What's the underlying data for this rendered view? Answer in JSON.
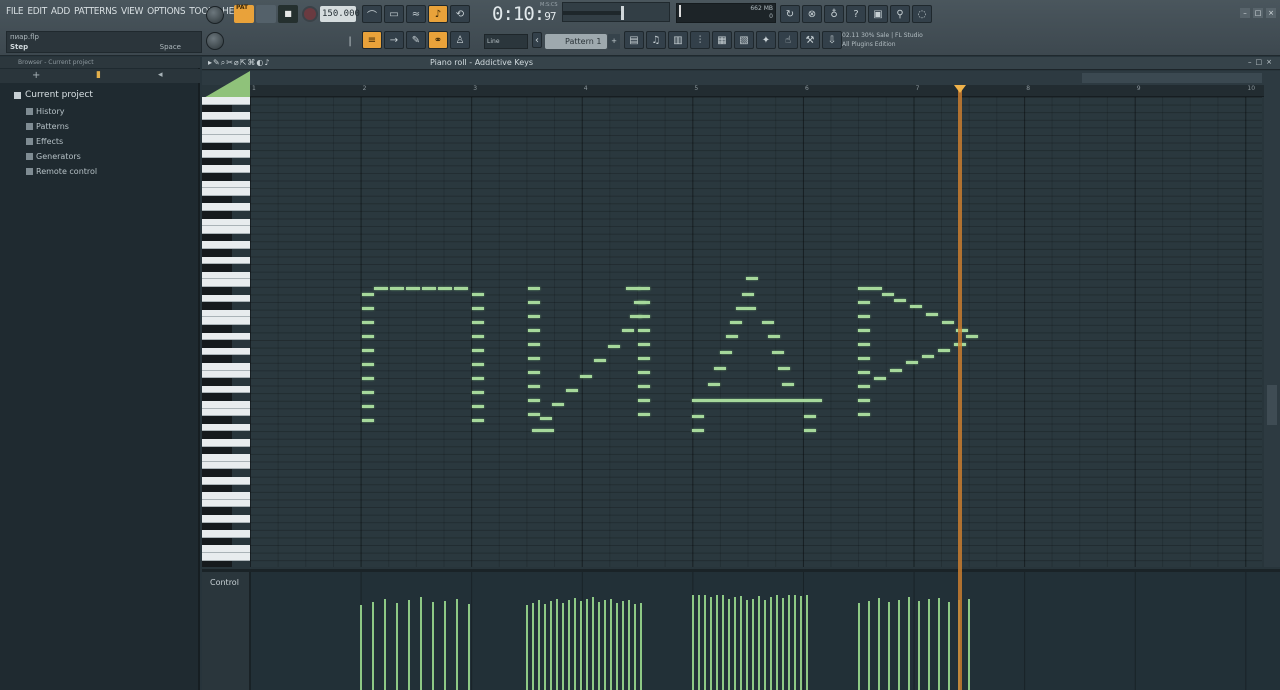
{
  "menu": [
    "FILE",
    "EDIT",
    "ADD",
    "PATTERNS",
    "VIEW",
    "OPTIONS",
    "TOOLS",
    "HELP"
  ],
  "hint": {
    "file": "пиар.flp",
    "step": "Step",
    "key": "Space"
  },
  "transport": {
    "tempo": "150.000",
    "time_main": "0:10",
    "time_sub": "97",
    "time_label": "M:S:CS",
    "pattern": "Pattern 1",
    "snap": "Line"
  },
  "cpu": {
    "ram": "662 MB",
    "poly": "0"
  },
  "news": {
    "line1": "02.11  30% Sale | FL Studio",
    "line2": "All Plugins Edition"
  },
  "browser": {
    "header": "Browser - Current project",
    "root": "Current project",
    "items": [
      "History",
      "Patterns",
      "Effects",
      "Generators",
      "Remote control"
    ]
  },
  "piano_roll": {
    "title": "Piano roll - Addictive Keys",
    "bars": [
      "1",
      "2",
      "3",
      "4",
      "5",
      "6",
      "7",
      "8",
      "9",
      "10"
    ],
    "event_label": "Control"
  },
  "colors": {
    "accent": "#e9a23a",
    "note": "#a6d89b",
    "playhead": "#c97c2f"
  }
}
